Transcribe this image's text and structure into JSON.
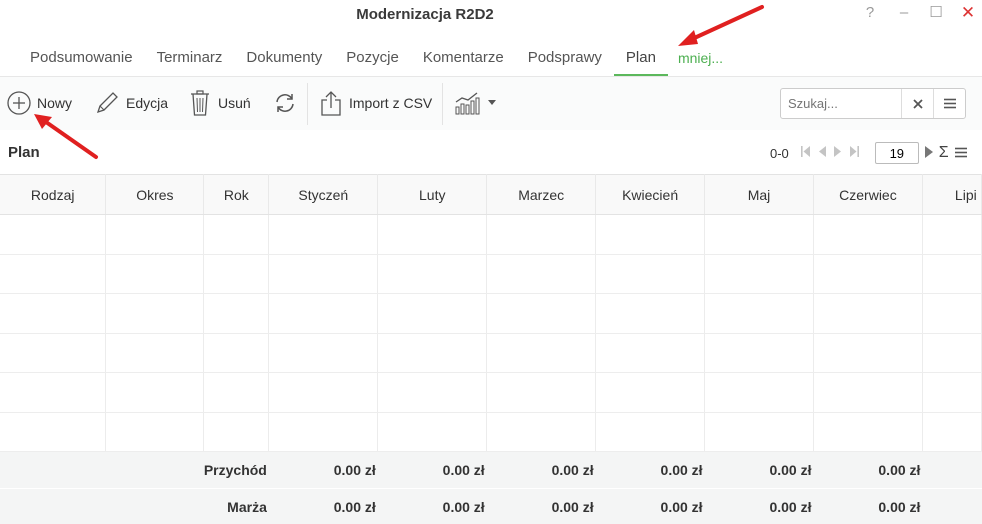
{
  "window": {
    "title": "Modernizacja R2D2",
    "help": "?",
    "minimize": "–",
    "maximize": "☐",
    "close": "✕"
  },
  "tabs": [
    {
      "label": "Podsumowanie",
      "active": false
    },
    {
      "label": "Terminarz",
      "active": false
    },
    {
      "label": "Dokumenty",
      "active": false
    },
    {
      "label": "Pozycje",
      "active": false
    },
    {
      "label": "Komentarze",
      "active": false
    },
    {
      "label": "Podsprawy",
      "active": false
    },
    {
      "label": "Plan",
      "active": true
    }
  ],
  "tabs_more": "mniej...",
  "toolbar": {
    "new_label": "Nowy",
    "edit_label": "Edycja",
    "delete_label": "Usuń",
    "import_label": "Import z CSV",
    "search_placeholder": "Szukaj..."
  },
  "section": {
    "title": "Plan",
    "count": "0-0",
    "page_size": "19"
  },
  "table": {
    "columns": [
      "Rodzaj",
      "Okres",
      "Rok",
      "Styczeń",
      "Luty",
      "Marzec",
      "Kwiecień",
      "Maj",
      "Czerwiec",
      "Lipi"
    ],
    "summary_rows": [
      {
        "label": "Przychód",
        "values": [
          "0.00 zł",
          "0.00 zł",
          "0.00 zł",
          "0.00 zł",
          "0.00 zł",
          "0.00 zł"
        ]
      },
      {
        "label": "Marża",
        "values": [
          "0.00 zł",
          "0.00 zł",
          "0.00 zł",
          "0.00 zł",
          "0.00 zł",
          "0.00 zł"
        ]
      }
    ]
  },
  "colors": {
    "accent_green": "#5cb85c",
    "annotation_red": "#e02020",
    "close_red": "#dd3333"
  },
  "icons": [
    "plus-circle-icon",
    "pencil-icon",
    "trash-icon",
    "refresh-icon",
    "upload-icon",
    "chart-icon",
    "clear-icon",
    "menu-icon",
    "first-page-icon",
    "prev-page-icon",
    "next-page-icon",
    "last-page-icon",
    "sigma-icon"
  ]
}
